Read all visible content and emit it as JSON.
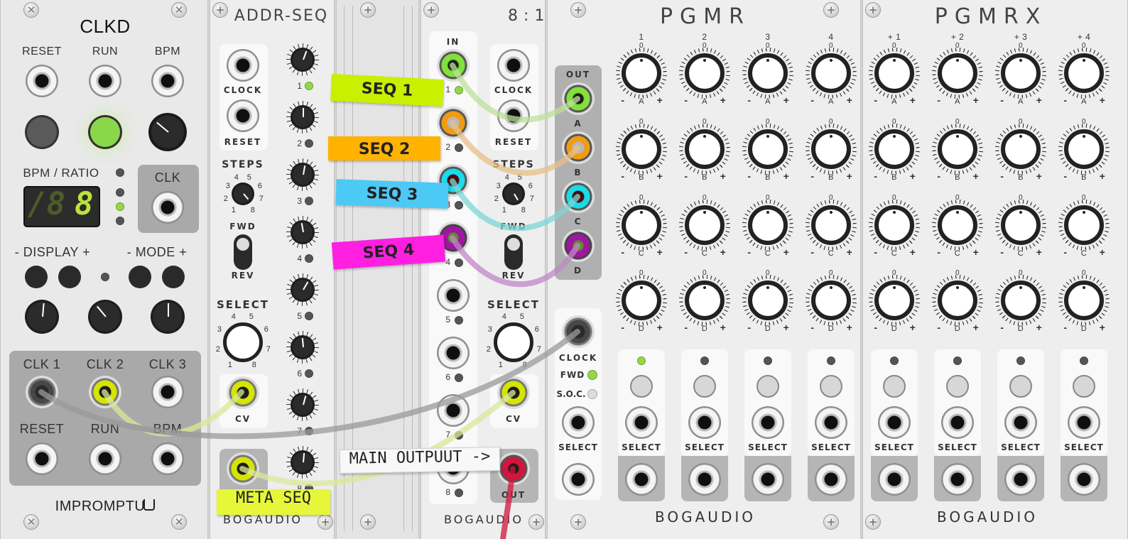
{
  "clkd": {
    "title": "CLKD",
    "reset": "RESET",
    "run": "RUN",
    "bpm": "BPM",
    "bpm_ratio": "BPM / RATIO",
    "display_value": "8",
    "clk": "CLK",
    "display_btns": "- DISPLAY +",
    "mode_btns": "- MODE +",
    "clk1": "CLK 1",
    "clk2": "CLK 2",
    "clk3": "CLK 3",
    "reset2": "RESET",
    "run2": "RUN",
    "bpm2": "BPM",
    "brand": "IMPROMPTU"
  },
  "addrseq": {
    "title": "ADDR-SEQ",
    "clock": "CLOCK",
    "reset": "RESET",
    "steps": "STEPS",
    "fwd": "FWD",
    "rev": "REV",
    "select": "SELECT",
    "cv": "CV",
    "brand": "BOGAUDIO",
    "step_labels": [
      "1",
      "2",
      "3",
      "4",
      "5",
      "6",
      "7",
      "8"
    ],
    "dial_labels": [
      "1",
      "2",
      "3",
      "4",
      "5",
      "6",
      "7",
      "8"
    ]
  },
  "eightone": {
    "title": "8 : 1",
    "in": "IN",
    "clock": "CLOCK",
    "reset": "RESET",
    "steps": "STEPS",
    "fwd": "FWD",
    "rev": "REV",
    "select": "SELECT",
    "cv": "CV",
    "out": "OUT",
    "brand": "BOGAUDIO",
    "step_labels": [
      "1",
      "2",
      "3",
      "4",
      "5",
      "6",
      "7",
      "8"
    ]
  },
  "pgmr": {
    "title": "PGMR",
    "out": "OUT",
    "clock": "CLOCK",
    "fwd": "FWD",
    "soc": "S.O.C.",
    "col_labels": [
      "1",
      "2",
      "3",
      "4"
    ],
    "row_labels": [
      "A",
      "B",
      "C",
      "D"
    ],
    "minus": "-",
    "plus": "+",
    "zero": "0",
    "select": "SELECT",
    "rows_out": [
      "A",
      "B",
      "C",
      "D"
    ],
    "brand": "BOGAUDIO"
  },
  "pgmrx": {
    "title": "PGMRX",
    "col_labels": [
      "+ 1",
      "+ 2",
      "+ 3",
      "+ 4"
    ],
    "row_labels": [
      "A",
      "B",
      "C",
      "D"
    ],
    "select": "SELECT",
    "brand": "BOGAUDIO"
  },
  "tapes": {
    "seq1": "SEQ 1",
    "seq2": "SEQ 2",
    "seq3": "SEQ 3",
    "seq4": "SEQ 4",
    "main": "MAIN OUTPUUT ->",
    "meta": "META SEQ"
  },
  "colors": {
    "tape_lime": "#c8f000",
    "tape_orange": "#ffb300",
    "tape_blue": "#4dc9f6",
    "tape_magenta": "#ff1fe0",
    "tape_yellow": "#e6f73a",
    "cable_yellow": "#dbe89a",
    "cable_grey": "#9a9a9a",
    "cable_orange": "#e7c088",
    "cable_cyan": "#7fd7d7",
    "cable_purple": "#c088c8",
    "cable_green": "#bde19a"
  }
}
